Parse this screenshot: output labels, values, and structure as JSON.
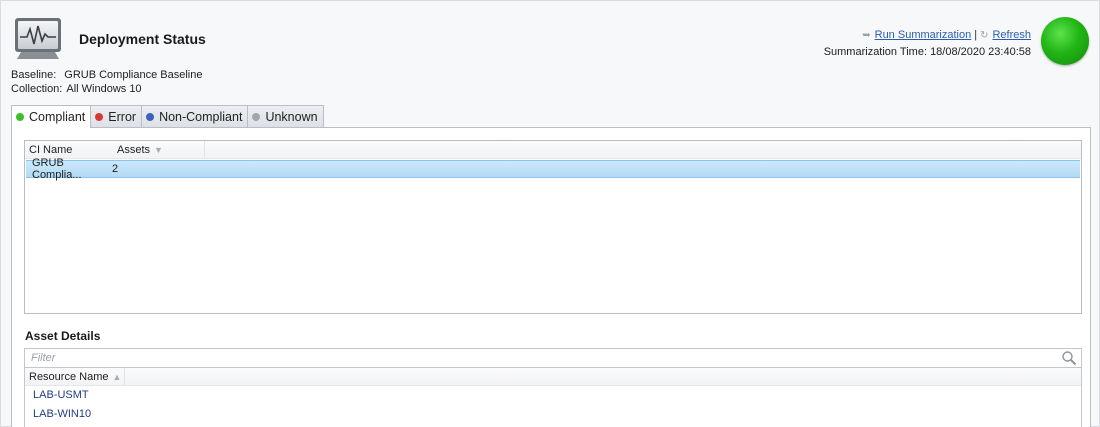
{
  "header": {
    "title": "Deployment Status",
    "icon": "monitor-pulse-icon",
    "baseline_label": "Baseline:",
    "baseline_value": "GRUB Compliance Baseline",
    "collection_label": "Collection:",
    "collection_value": "All Windows 10"
  },
  "actions": {
    "run_summarization": "Run Summarization",
    "separator": "|",
    "refresh": "Refresh",
    "summarization_label": "Summarization Time:",
    "summarization_time": "18/08/2020 23:40:58"
  },
  "status": {
    "color": "#22b515"
  },
  "tabs": [
    {
      "label": "Compliant",
      "color": "#3bbf2a",
      "active": true
    },
    {
      "label": "Error",
      "color": "#d63b33",
      "active": false
    },
    {
      "label": "Non-Compliant",
      "color": "#3c63b4",
      "active": false
    },
    {
      "label": "Unknown",
      "color": "#a3a7ad",
      "active": false
    }
  ],
  "ci_grid": {
    "columns": [
      "CI Name",
      "Assets"
    ],
    "rows": [
      {
        "ci_name": "GRUB Complia...",
        "assets": "2"
      }
    ]
  },
  "asset_details": {
    "title": "Asset Details",
    "filter_placeholder": "Filter",
    "columns": [
      "Resource Name"
    ],
    "rows": [
      "LAB-USMT",
      "LAB-WIN10"
    ]
  }
}
